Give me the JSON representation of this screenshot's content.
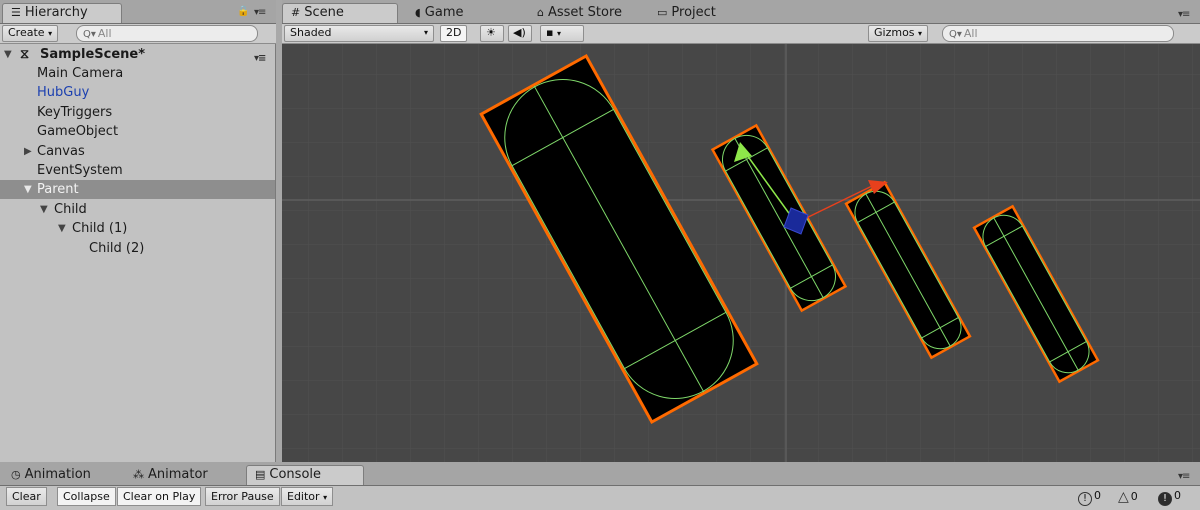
{
  "hierarchy": {
    "tab_label": "Hierarchy",
    "create_label": "Create",
    "search_placeholder": "All",
    "scene_name": "SampleScene*",
    "items": [
      {
        "label": "Main Camera"
      },
      {
        "label": "HubGuy"
      },
      {
        "label": "KeyTriggers"
      },
      {
        "label": "GameObject"
      },
      {
        "label": "Canvas"
      },
      {
        "label": "EventSystem"
      },
      {
        "label": "Parent"
      },
      {
        "label": "Child"
      },
      {
        "label": "Child (1)"
      },
      {
        "label": "Child (2)"
      }
    ]
  },
  "scene": {
    "tabs": [
      {
        "label": "Scene"
      },
      {
        "label": "Game"
      },
      {
        "label": "Asset Store"
      },
      {
        "label": "Project"
      }
    ],
    "shading_mode": "Shaded",
    "mode_2d_label": "2D",
    "gizmos_label": "Gizmos",
    "search_placeholder": "All",
    "colors": {
      "background": "#474747",
      "selection_outline": "#ff6a00",
      "collider": "#7fd86a",
      "handle_y": "#8ee84a",
      "handle_x": "#e8401c",
      "handle_center": "#1a2a9a"
    }
  },
  "bottom": {
    "tabs": [
      {
        "label": "Animation"
      },
      {
        "label": "Animator"
      },
      {
        "label": "Console"
      }
    ],
    "buttons": {
      "clear": "Clear",
      "collapse": "Collapse",
      "clear_on_play": "Clear on Play",
      "error_pause": "Error Pause",
      "editor": "Editor"
    },
    "counts": {
      "log": "0",
      "warning": "0",
      "error": "0"
    }
  }
}
